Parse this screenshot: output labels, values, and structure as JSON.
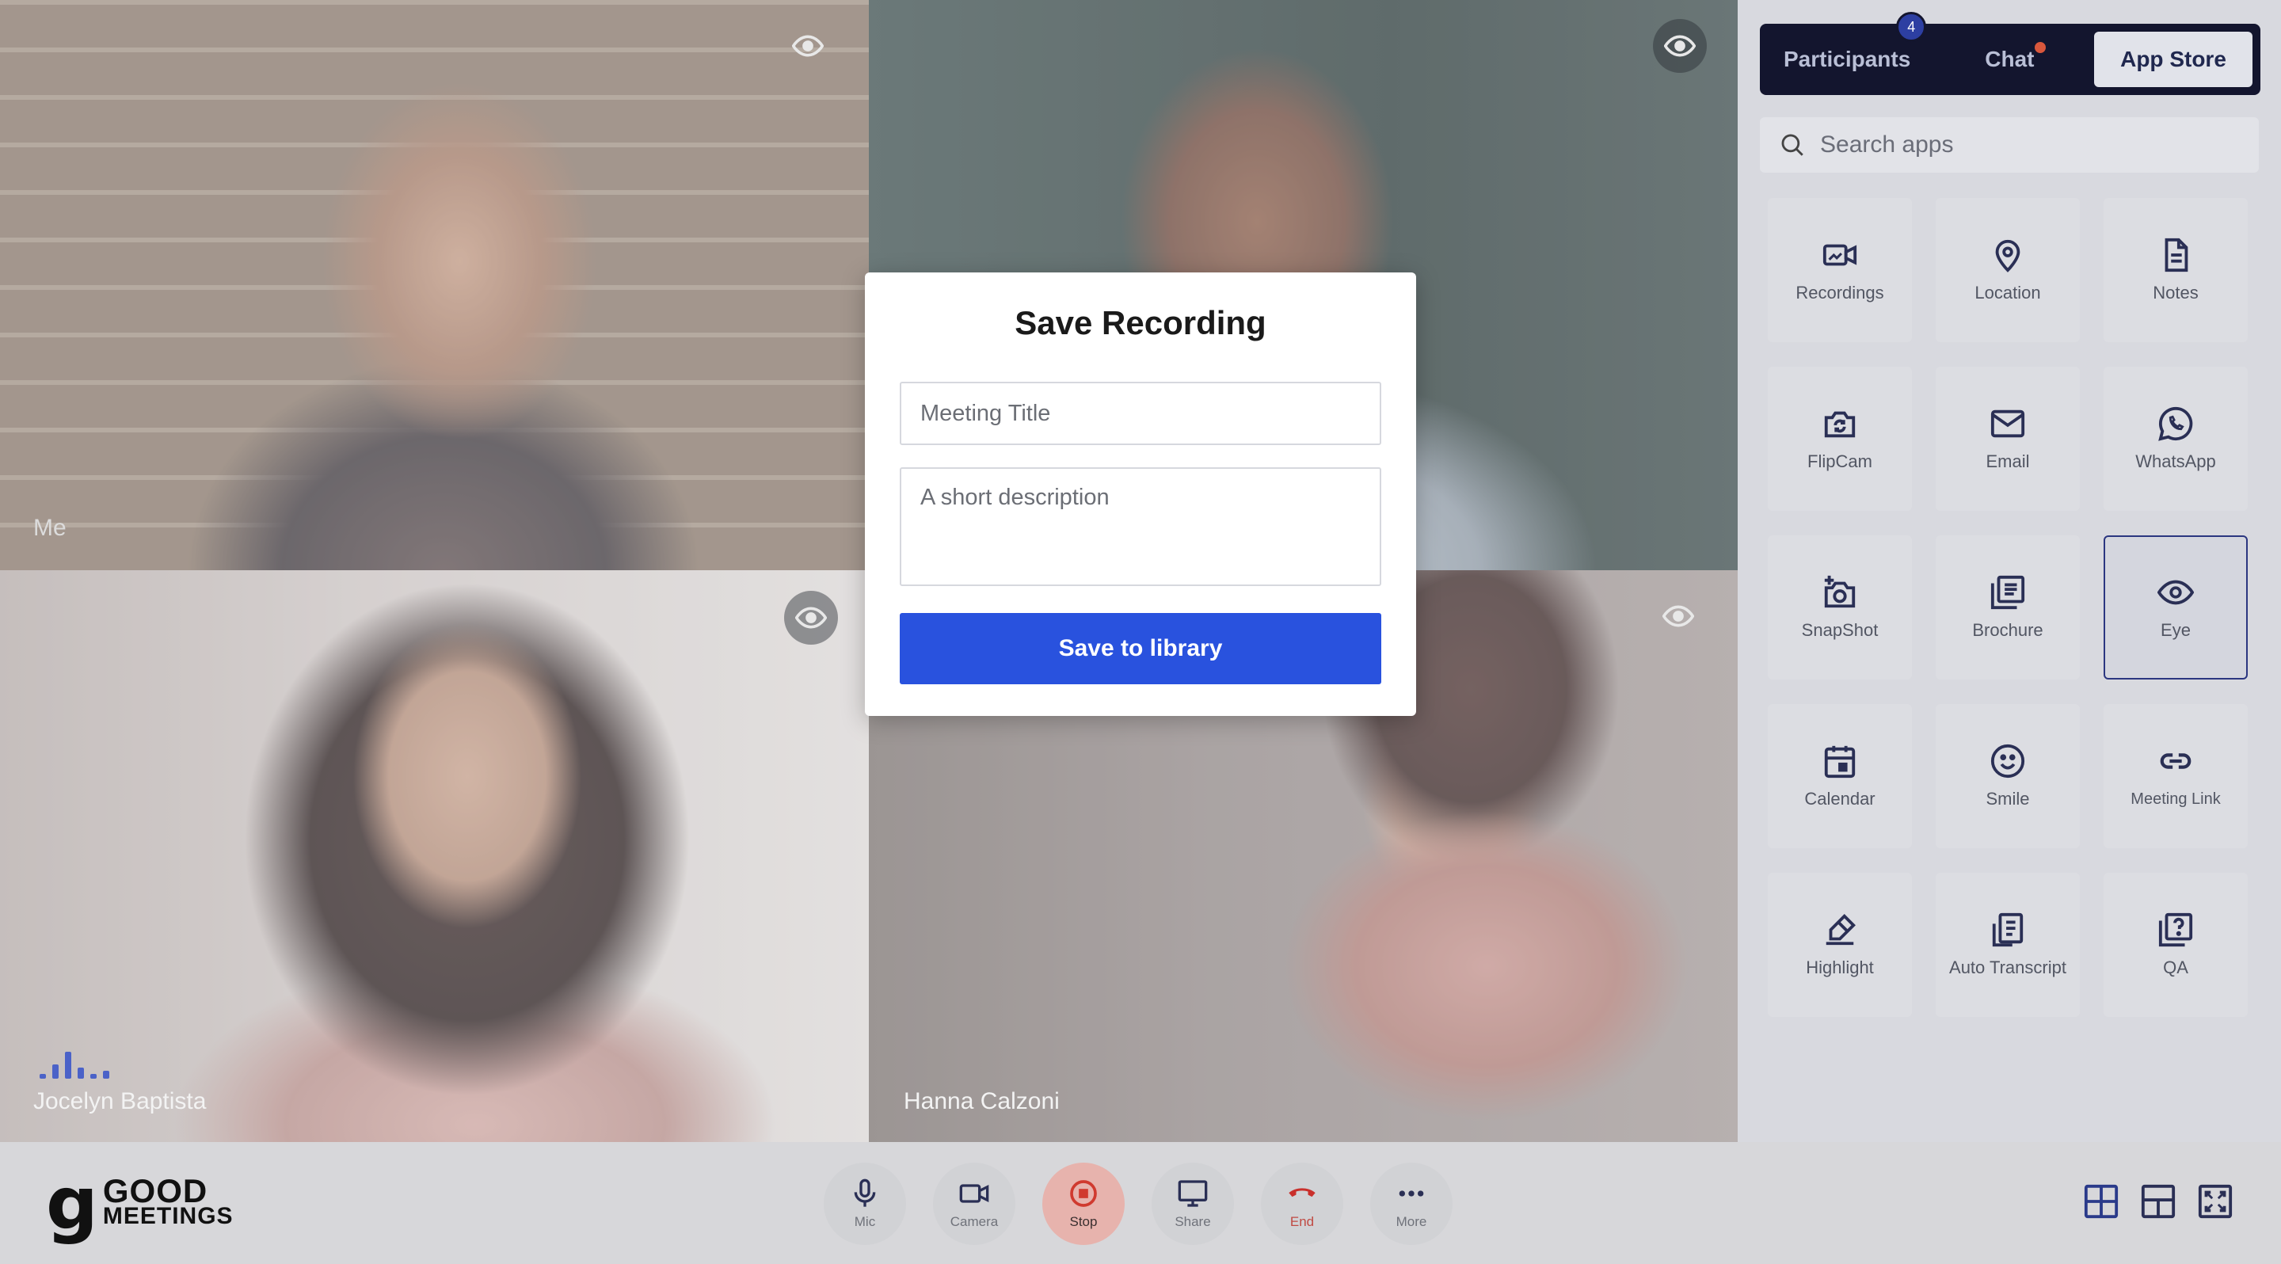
{
  "video_tiles": [
    {
      "name": "Me",
      "eye_icon": "eye-icon"
    },
    {
      "name": "",
      "eye_icon": "eye-icon"
    },
    {
      "name": "Jocelyn Baptista",
      "eye_icon": "eye-icon",
      "speaking": true
    },
    {
      "name": "Hanna Calzoni",
      "eye_icon": "eye-icon"
    }
  ],
  "panel": {
    "tabs": {
      "participants": "Participants",
      "participants_badge": "4",
      "chat": "Chat",
      "app_store": "App Store"
    },
    "search_placeholder": "Search apps",
    "apps": [
      {
        "label": "Recordings",
        "icon": "video-icon"
      },
      {
        "label": "Location",
        "icon": "location-pin-icon"
      },
      {
        "label": "Notes",
        "icon": "document-icon"
      },
      {
        "label": "FlipCam",
        "icon": "flip-camera-icon"
      },
      {
        "label": "Email",
        "icon": "envelope-icon"
      },
      {
        "label": "WhatsApp",
        "icon": "whatsapp-icon"
      },
      {
        "label": "SnapShot",
        "icon": "snapshot-camera-icon"
      },
      {
        "label": "Brochure",
        "icon": "brochure-icon"
      },
      {
        "label": "Eye",
        "icon": "eye-icon",
        "selected": true
      },
      {
        "label": "Calendar",
        "icon": "calendar-icon"
      },
      {
        "label": "Smile",
        "icon": "smile-icon"
      },
      {
        "label": "Meeting Link",
        "icon": "link-icon"
      },
      {
        "label": "Highlight",
        "icon": "highlighter-icon"
      },
      {
        "label": "Auto Transcript",
        "icon": "transcript-icon"
      },
      {
        "label": "QA",
        "icon": "question-icon"
      }
    ]
  },
  "modal": {
    "title": "Save Recording",
    "title_placeholder": "Meeting Title",
    "description_placeholder": "A short description",
    "save_label": "Save to library"
  },
  "bottom_bar": {
    "logo_line1": "GOOD",
    "logo_line2": "MEETINGS",
    "controls": {
      "mic": "Mic",
      "camera": "Camera",
      "stop": "Stop",
      "share": "Share",
      "end": "End",
      "more": "More"
    },
    "view_icons": [
      "grid-view-icon",
      "layout-view-icon",
      "fullscreen-icon"
    ]
  },
  "colors": {
    "accent": "#2952de",
    "tabs_bg": "#13152e",
    "selected_border": "#2b3680",
    "stop_bg": "#e7b3ad",
    "end_red": "#c04a43"
  }
}
